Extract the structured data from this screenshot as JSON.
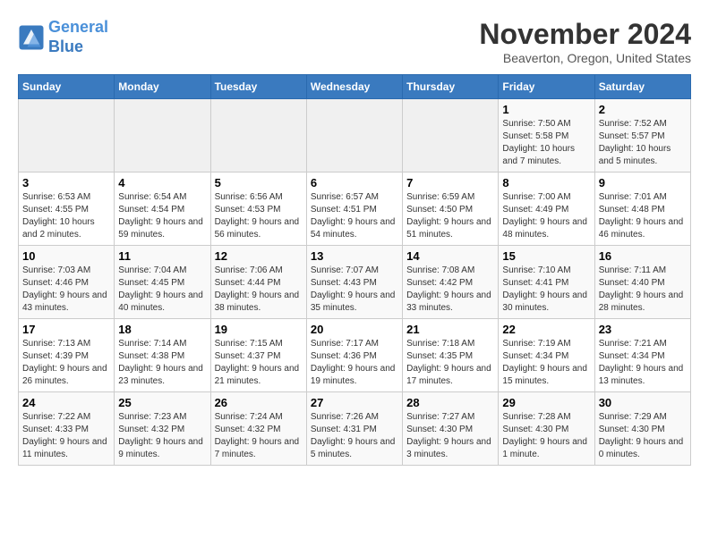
{
  "header": {
    "logo_line1": "General",
    "logo_line2": "Blue",
    "month_title": "November 2024",
    "location": "Beaverton, Oregon, United States"
  },
  "days_of_week": [
    "Sunday",
    "Monday",
    "Tuesday",
    "Wednesday",
    "Thursday",
    "Friday",
    "Saturday"
  ],
  "weeks": [
    [
      {
        "day": "",
        "info": ""
      },
      {
        "day": "",
        "info": ""
      },
      {
        "day": "",
        "info": ""
      },
      {
        "day": "",
        "info": ""
      },
      {
        "day": "",
        "info": ""
      },
      {
        "day": "1",
        "info": "Sunrise: 7:50 AM\nSunset: 5:58 PM\nDaylight: 10 hours and 7 minutes."
      },
      {
        "day": "2",
        "info": "Sunrise: 7:52 AM\nSunset: 5:57 PM\nDaylight: 10 hours and 5 minutes."
      }
    ],
    [
      {
        "day": "3",
        "info": "Sunrise: 6:53 AM\nSunset: 4:55 PM\nDaylight: 10 hours and 2 minutes."
      },
      {
        "day": "4",
        "info": "Sunrise: 6:54 AM\nSunset: 4:54 PM\nDaylight: 9 hours and 59 minutes."
      },
      {
        "day": "5",
        "info": "Sunrise: 6:56 AM\nSunset: 4:53 PM\nDaylight: 9 hours and 56 minutes."
      },
      {
        "day": "6",
        "info": "Sunrise: 6:57 AM\nSunset: 4:51 PM\nDaylight: 9 hours and 54 minutes."
      },
      {
        "day": "7",
        "info": "Sunrise: 6:59 AM\nSunset: 4:50 PM\nDaylight: 9 hours and 51 minutes."
      },
      {
        "day": "8",
        "info": "Sunrise: 7:00 AM\nSunset: 4:49 PM\nDaylight: 9 hours and 48 minutes."
      },
      {
        "day": "9",
        "info": "Sunrise: 7:01 AM\nSunset: 4:48 PM\nDaylight: 9 hours and 46 minutes."
      }
    ],
    [
      {
        "day": "10",
        "info": "Sunrise: 7:03 AM\nSunset: 4:46 PM\nDaylight: 9 hours and 43 minutes."
      },
      {
        "day": "11",
        "info": "Sunrise: 7:04 AM\nSunset: 4:45 PM\nDaylight: 9 hours and 40 minutes."
      },
      {
        "day": "12",
        "info": "Sunrise: 7:06 AM\nSunset: 4:44 PM\nDaylight: 9 hours and 38 minutes."
      },
      {
        "day": "13",
        "info": "Sunrise: 7:07 AM\nSunset: 4:43 PM\nDaylight: 9 hours and 35 minutes."
      },
      {
        "day": "14",
        "info": "Sunrise: 7:08 AM\nSunset: 4:42 PM\nDaylight: 9 hours and 33 minutes."
      },
      {
        "day": "15",
        "info": "Sunrise: 7:10 AM\nSunset: 4:41 PM\nDaylight: 9 hours and 30 minutes."
      },
      {
        "day": "16",
        "info": "Sunrise: 7:11 AM\nSunset: 4:40 PM\nDaylight: 9 hours and 28 minutes."
      }
    ],
    [
      {
        "day": "17",
        "info": "Sunrise: 7:13 AM\nSunset: 4:39 PM\nDaylight: 9 hours and 26 minutes."
      },
      {
        "day": "18",
        "info": "Sunrise: 7:14 AM\nSunset: 4:38 PM\nDaylight: 9 hours and 23 minutes."
      },
      {
        "day": "19",
        "info": "Sunrise: 7:15 AM\nSunset: 4:37 PM\nDaylight: 9 hours and 21 minutes."
      },
      {
        "day": "20",
        "info": "Sunrise: 7:17 AM\nSunset: 4:36 PM\nDaylight: 9 hours and 19 minutes."
      },
      {
        "day": "21",
        "info": "Sunrise: 7:18 AM\nSunset: 4:35 PM\nDaylight: 9 hours and 17 minutes."
      },
      {
        "day": "22",
        "info": "Sunrise: 7:19 AM\nSunset: 4:34 PM\nDaylight: 9 hours and 15 minutes."
      },
      {
        "day": "23",
        "info": "Sunrise: 7:21 AM\nSunset: 4:34 PM\nDaylight: 9 hours and 13 minutes."
      }
    ],
    [
      {
        "day": "24",
        "info": "Sunrise: 7:22 AM\nSunset: 4:33 PM\nDaylight: 9 hours and 11 minutes."
      },
      {
        "day": "25",
        "info": "Sunrise: 7:23 AM\nSunset: 4:32 PM\nDaylight: 9 hours and 9 minutes."
      },
      {
        "day": "26",
        "info": "Sunrise: 7:24 AM\nSunset: 4:32 PM\nDaylight: 9 hours and 7 minutes."
      },
      {
        "day": "27",
        "info": "Sunrise: 7:26 AM\nSunset: 4:31 PM\nDaylight: 9 hours and 5 minutes."
      },
      {
        "day": "28",
        "info": "Sunrise: 7:27 AM\nSunset: 4:30 PM\nDaylight: 9 hours and 3 minutes."
      },
      {
        "day": "29",
        "info": "Sunrise: 7:28 AM\nSunset: 4:30 PM\nDaylight: 9 hours and 1 minute."
      },
      {
        "day": "30",
        "info": "Sunrise: 7:29 AM\nSunset: 4:30 PM\nDaylight: 9 hours and 0 minutes."
      }
    ]
  ]
}
